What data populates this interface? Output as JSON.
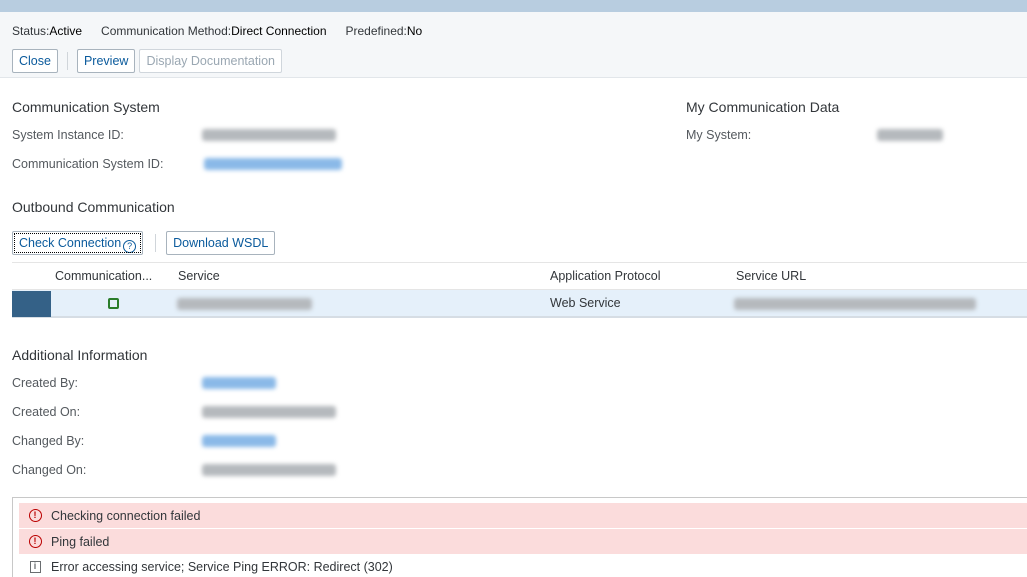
{
  "header": {
    "status_label": "Status:",
    "status_value": "Active",
    "method_label": "Communication Method:",
    "method_value": "Direct Connection",
    "predefined_label": "Predefined:",
    "predefined_value": "No"
  },
  "toolbar": {
    "close_label": "Close",
    "preview_label": "Preview",
    "display_doc_label": "Display Documentation"
  },
  "communication_system": {
    "title": "Communication System",
    "system_instance_label": "System Instance ID:",
    "communication_system_label": "Communication System ID:"
  },
  "my_communication": {
    "title": "My Communication Data",
    "my_system_label": "My System:"
  },
  "outbound": {
    "title": "Outbound Communication",
    "check_connection_label": "Check Connection",
    "download_wsdl_label": "Download WSDL",
    "columns": [
      "Communication...",
      "Service",
      "Application Protocol",
      "Service URL"
    ],
    "rows": [
      {
        "application_protocol": "Web Service"
      }
    ]
  },
  "additional": {
    "title": "Additional Information",
    "created_by_label": "Created By:",
    "created_on_label": "Created On:",
    "changed_by_label": "Changed By:",
    "changed_on_label": "Changed On:"
  },
  "messages": [
    {
      "type": "error",
      "icon": "error-icon",
      "text": "Checking connection failed"
    },
    {
      "type": "error",
      "icon": "error-icon",
      "text": "Ping failed"
    },
    {
      "type": "info",
      "icon": "info-icon",
      "text": "Error accessing service; Service Ping ERROR: Redirect (302)"
    }
  ],
  "colors": {
    "link": "#0a5a9c",
    "error_bg": "#fbdcdc",
    "selection": "#346187",
    "row_selected_bg": "#e5f0fa"
  }
}
